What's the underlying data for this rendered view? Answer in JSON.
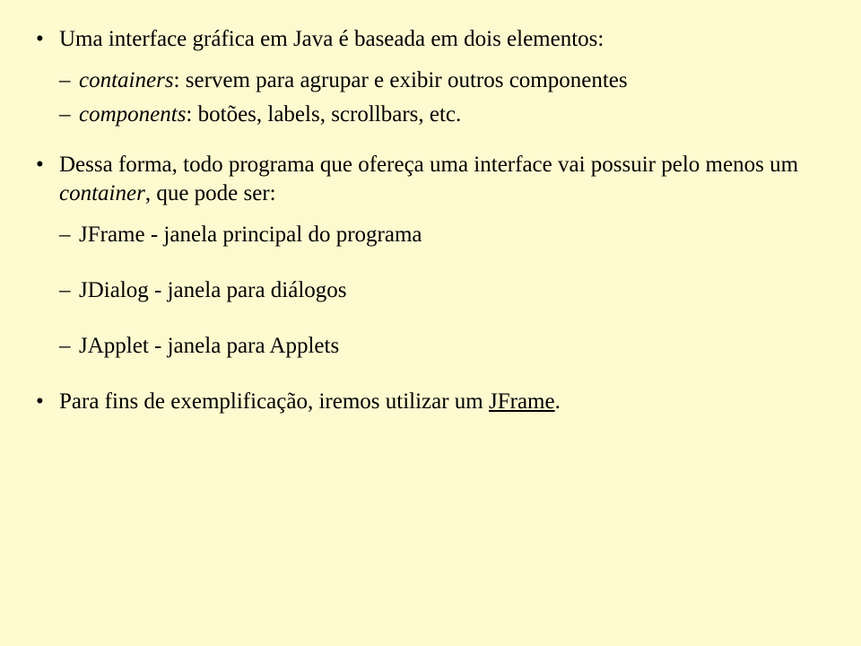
{
  "bullets": {
    "b1": {
      "text": "Uma interface gráfica em Java é baseada em dois elementos:",
      "sub": {
        "s1": {
          "term": "containers",
          "rest": ": servem para agrupar e exibir outros componentes"
        },
        "s2": {
          "term": "components",
          "rest": ": botões, labels, scrollbars, etc."
        }
      }
    },
    "b2": {
      "pre": "Dessa forma, todo programa que ofereça uma interface vai possuir pelo menos um ",
      "term": "container",
      "post": ", que pode ser:",
      "sub": {
        "s1": {
          "name": "JFrame",
          "desc": " - janela principal do programa"
        },
        "s2": {
          "name": "JDialog",
          "desc": " - janela para diálogos"
        },
        "s3": {
          "name": "JApplet",
          "desc": " - janela para Applets"
        }
      }
    },
    "b3": {
      "pre": "Para fins de exemplificação, iremos utilizar um ",
      "link": "JFrame",
      "post": "."
    }
  }
}
